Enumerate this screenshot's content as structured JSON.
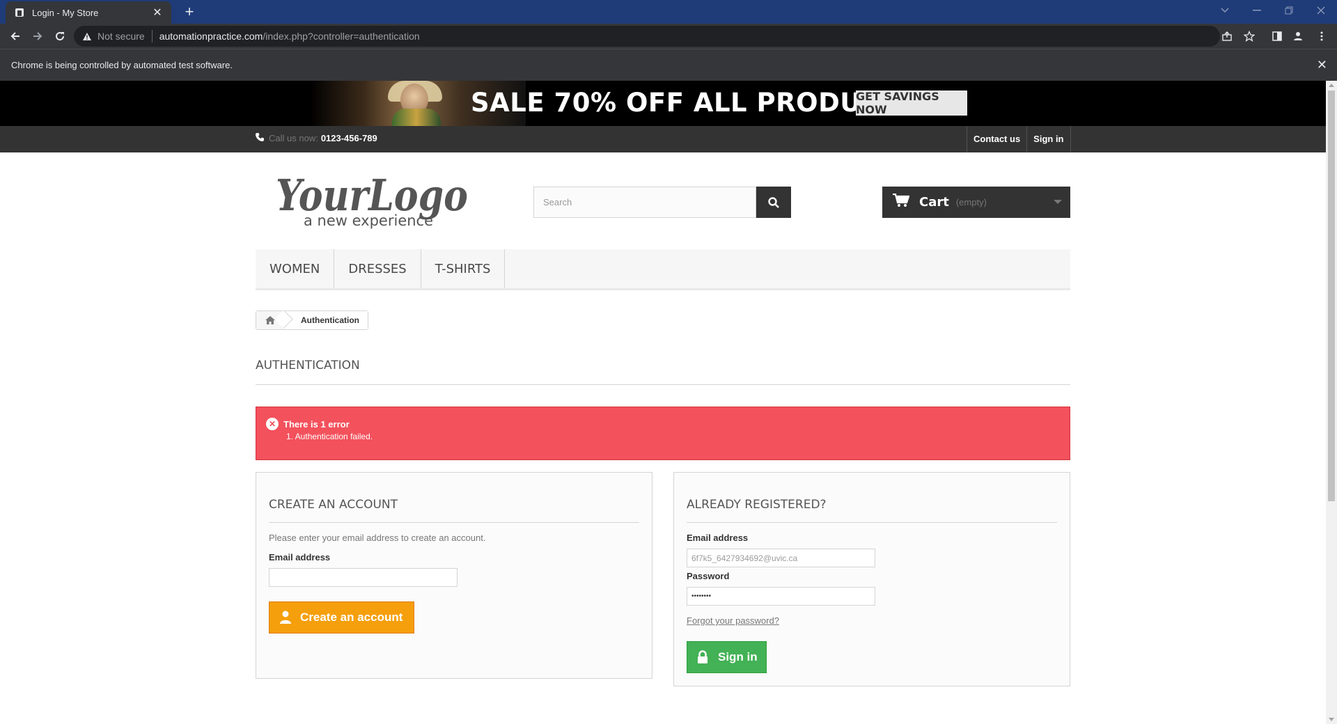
{
  "browser": {
    "tab_title": "Login - My Store",
    "url_warning": "Not secure",
    "url_host": "automationpractice.com",
    "url_path": "/index.php?controller=authentication",
    "infobar_text": "Chrome is being controlled by automated test software."
  },
  "banner": {
    "sale_text": "SALE 70% OFF ALL PRODUCTS",
    "cta_label": "GET SAVINGS NOW"
  },
  "topnav": {
    "call_label": "Call us now:",
    "phone": "0123-456-789",
    "contact_label": "Contact us",
    "signin_label": "Sign in"
  },
  "header": {
    "logo_main": "YourLogo",
    "logo_tagline": "a new experience",
    "search_placeholder": "Search",
    "cart_label": "Cart",
    "cart_state": "(empty)"
  },
  "menu": [
    {
      "label": "WOMEN"
    },
    {
      "label": "DRESSES"
    },
    {
      "label": "T-SHIRTS"
    }
  ],
  "breadcrumb": {
    "current": "Authentication"
  },
  "page_title": "AUTHENTICATION",
  "alert": {
    "icon": "x-circle-icon",
    "heading": "There is 1 error",
    "items": [
      "1. Authentication failed."
    ],
    "color": "#f3515c"
  },
  "create_account": {
    "heading": "CREATE AN ACCOUNT",
    "intro": "Please enter your email address to create an account.",
    "email_label": "Email address",
    "email_value": "",
    "button_label": "Create an account",
    "button_color": "#f59f0d"
  },
  "login": {
    "heading": "ALREADY REGISTERED?",
    "email_label": "Email address",
    "email_value": "6f7k5_6427934692@uvic.ca",
    "password_label": "Password",
    "password_value": "••••••••",
    "forgot_label": "Forgot your password?",
    "button_label": "Sign in",
    "button_color": "#43b155"
  }
}
